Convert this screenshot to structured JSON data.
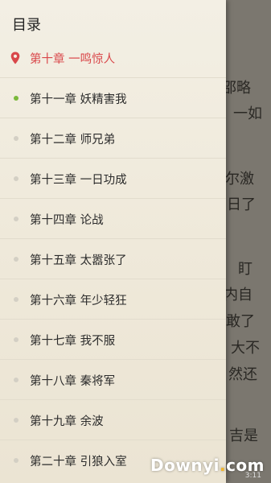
{
  "drawer": {
    "title": "目录",
    "chapters": [
      {
        "label": "第十章 一鸣惊人",
        "state": "current"
      },
      {
        "label": "第十一章 妖精害我",
        "state": "read"
      },
      {
        "label": "第十二章 师兄弟",
        "state": "unread"
      },
      {
        "label": "第十三章 一日功成",
        "state": "unread"
      },
      {
        "label": "第十四章 论战",
        "state": "unread"
      },
      {
        "label": "第十五章 太嚣张了",
        "state": "unread"
      },
      {
        "label": "第十六章 年少轻狂",
        "state": "unread"
      },
      {
        "label": "第十七章 我不服",
        "state": "unread"
      },
      {
        "label": "第十八章 秦将军",
        "state": "unread"
      },
      {
        "label": "第十九章 余波",
        "state": "unread"
      },
      {
        "label": "第二十章 引狼入室",
        "state": "unread"
      }
    ]
  },
  "reader": {
    "lines": [
      "邵略",
      "一如",
      "尔激",
      "日了",
      "盯",
      "内自",
      "敢了",
      "大不",
      "然还",
      "吉是"
    ]
  },
  "status": {
    "time": "3:11"
  },
  "watermark": {
    "text_main": "Downyi",
    "text_dot": ".",
    "text_com": "com"
  },
  "colors": {
    "current": "#d9474a",
    "read_dot": "#7ab83a",
    "unread_dot": "#d3cfc4"
  }
}
